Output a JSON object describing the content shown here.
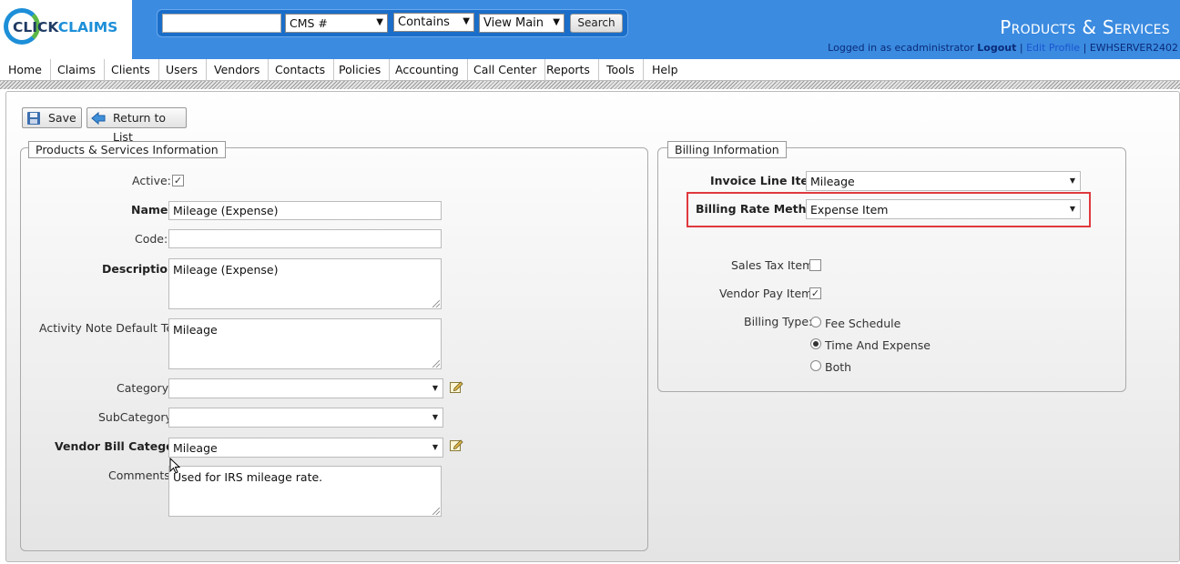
{
  "app": {
    "logo_part1": "CLICK",
    "logo_part2": "CLAIMS",
    "page_title": "Products & Services",
    "login_prefix": "Logged in as ecadministrator",
    "logout_label": "Logout",
    "edit_profile_label": "Edit Profile",
    "server": "EWHSERVER2402"
  },
  "search": {
    "query_value": "",
    "field_select": "CMS #",
    "match_select": "Contains",
    "view_select": "View Main",
    "search_button": "Search"
  },
  "nav": {
    "items": [
      "Home",
      "Claims",
      "Clients",
      "Users",
      "Vendors",
      "Contacts",
      "Policies",
      "Accounting",
      "Call Center",
      "Reports",
      "Tools",
      "Help"
    ]
  },
  "toolbar": {
    "save_label": "Save",
    "return_label": "Return to List"
  },
  "products_section": {
    "legend": "Products & Services Information",
    "active_label": "Active:",
    "active_checked": true,
    "name_label": "Name:",
    "name_value": "Mileage (Expense)",
    "code_label": "Code:",
    "code_value": "",
    "description_label": "Description:",
    "description_value": "Mileage (Expense)",
    "activity_label": "Activity Note Default Text:",
    "activity_value": "Mileage",
    "category_label": "Category:",
    "category_value": "",
    "subcategory_label": "SubCategory:",
    "subcategory_value": "",
    "vendor_bill_label": "Vendor Bill Category:",
    "vendor_bill_value": "Mileage",
    "comments_label": "Comments:",
    "comments_value": "Used for IRS mileage rate."
  },
  "billing_section": {
    "legend": "Billing Information",
    "invoice_label": "Invoice Line Item:",
    "invoice_value": "Mileage",
    "rate_method_label": "Billing Rate Method:",
    "rate_method_value": "Expense Item",
    "sales_tax_label": "Sales Tax Item:",
    "sales_tax_checked": false,
    "vendor_pay_label": "Vendor Pay Item:",
    "vendor_pay_checked": true,
    "billing_type_label": "Billing Type:",
    "billing_type_options": [
      "Fee Schedule",
      "Time And Expense",
      "Both"
    ],
    "billing_type_selected": "Time And Expense"
  },
  "colors": {
    "header_blue": "#3b8be0",
    "highlight_red": "#e0393e"
  }
}
